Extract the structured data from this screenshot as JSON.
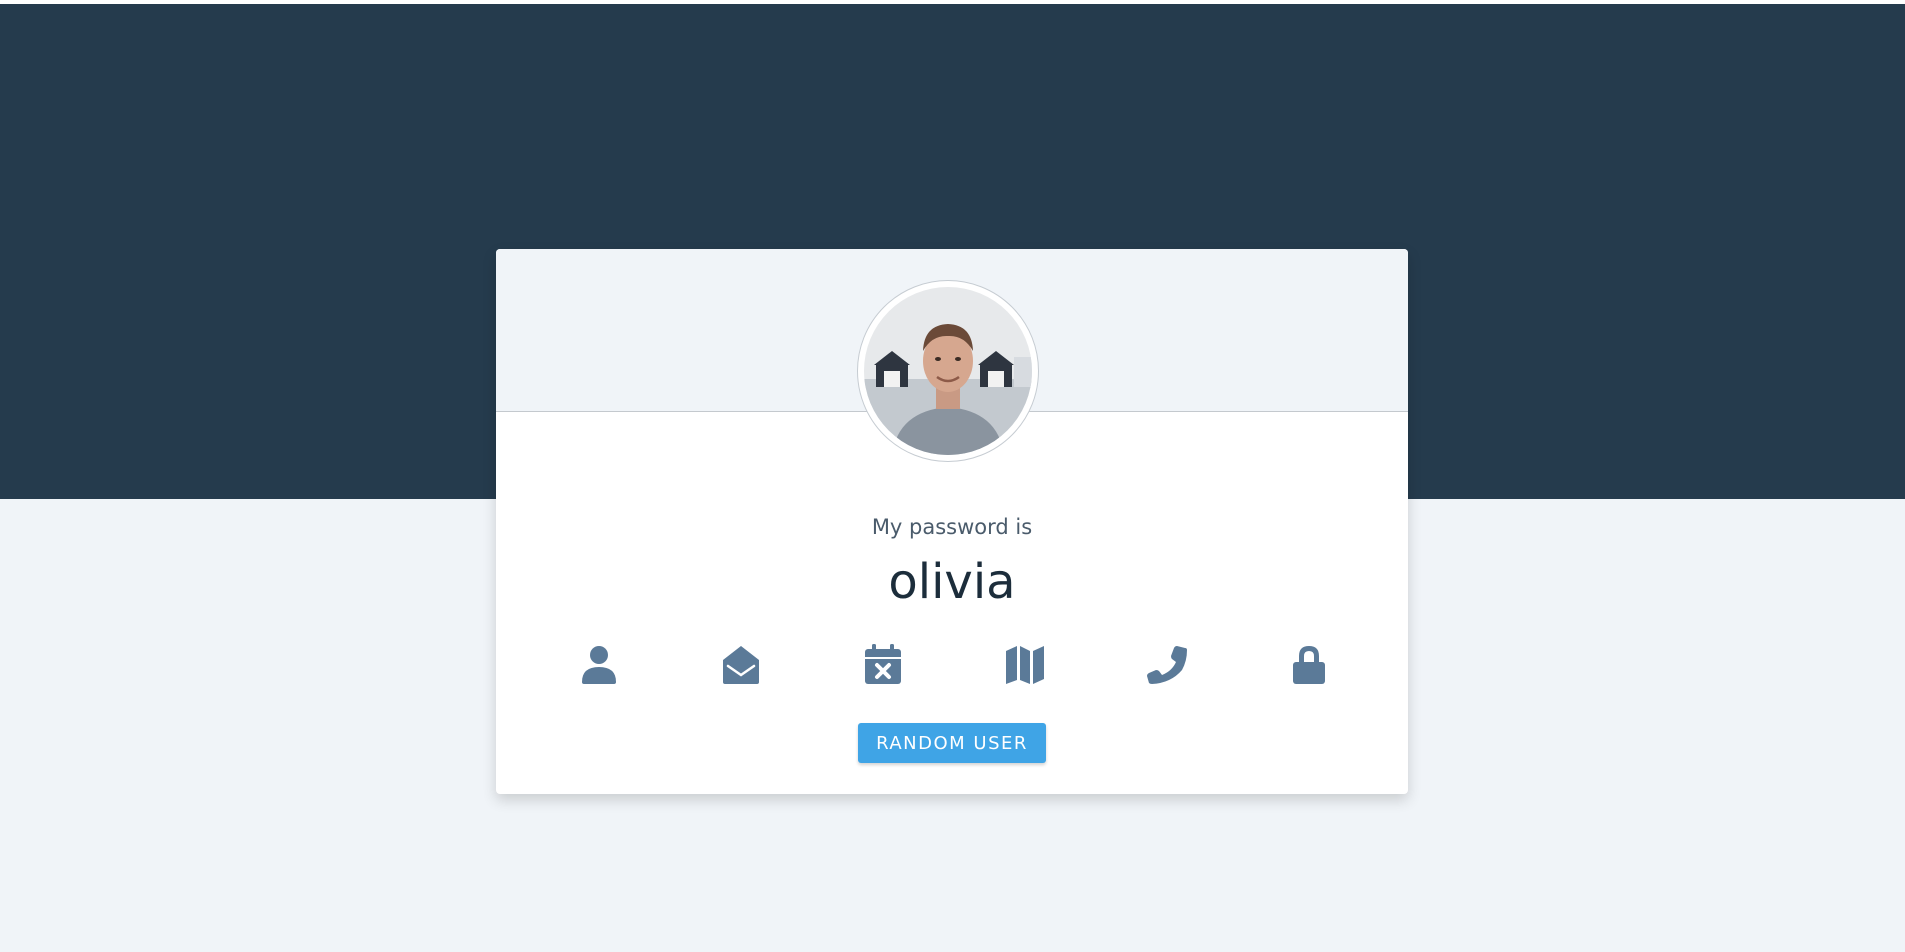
{
  "theme": {
    "hero_color": "#253b4d",
    "page_bg": "#f0f4f8",
    "icon_color": "#5b7a98",
    "button_color": "#3fa4e6"
  },
  "profile": {
    "label": "My password is",
    "value": "olivia"
  },
  "icons": [
    {
      "name": "user-icon"
    },
    {
      "name": "envelope-open-icon"
    },
    {
      "name": "calendar-x-icon"
    },
    {
      "name": "map-icon"
    },
    {
      "name": "phone-icon"
    },
    {
      "name": "lock-icon"
    }
  ],
  "actions": {
    "random_user_label": "RANDOM USER"
  }
}
